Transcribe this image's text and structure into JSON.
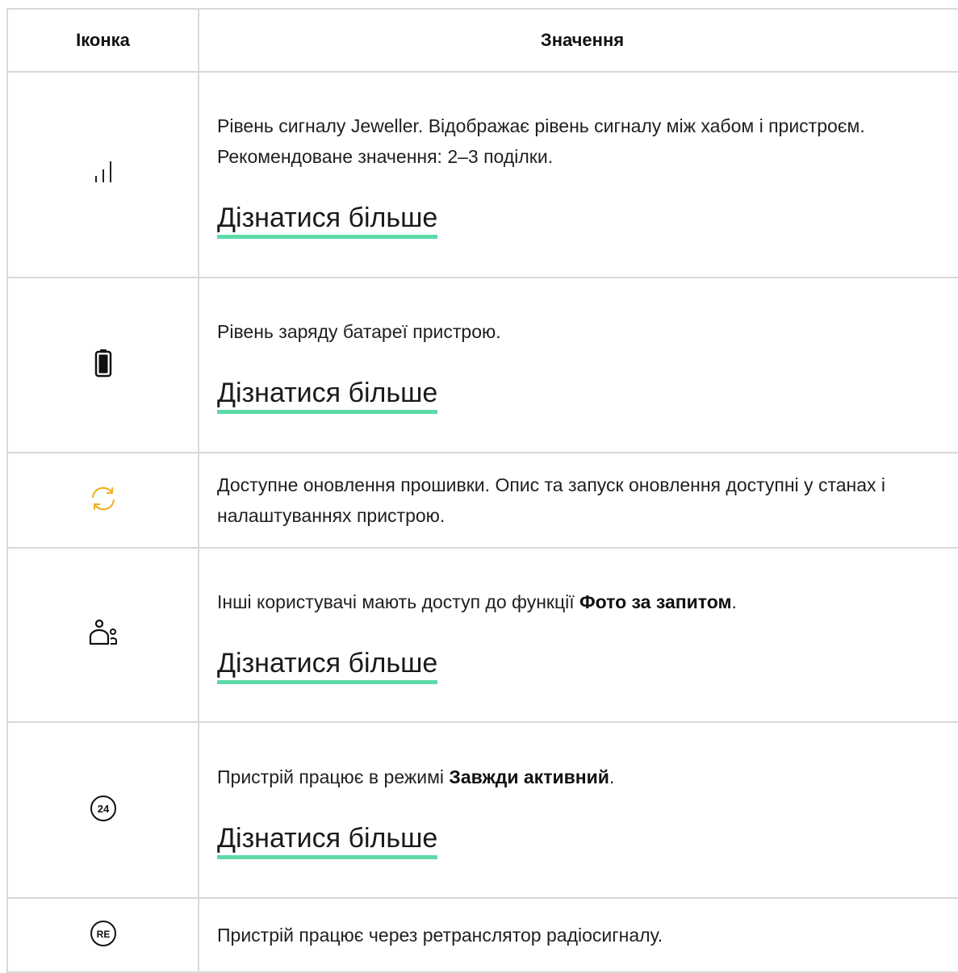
{
  "table": {
    "headers": {
      "icon": "Іконка",
      "meaning": "Значення"
    },
    "rows": [
      {
        "icon": "signal-strength-icon",
        "text": "Рівень сигналу Jeweller. Відображає рівень сигналу між хабом і пристроєм. Рекомендоване значення: 2–3 поділки.",
        "link": "Дізнатися більше"
      },
      {
        "icon": "battery-icon",
        "text": "Рівень заряду батареї пристрою.",
        "link": "Дізнатися більше"
      },
      {
        "icon": "firmware-update-icon",
        "text": "Доступне оновлення прошивки. Опис та запуск оновлення доступні у станах і налаштуваннях пристрою."
      },
      {
        "icon": "users-access-icon",
        "text_before": "Інші користувачі мають доступ до функції ",
        "text_bold": "Фото за запитом",
        "text_after": ".",
        "link": "Дізнатися більше"
      },
      {
        "icon": "always-active-24-icon",
        "icon_label": "24",
        "text_before": "Пристрій працює в режимі ",
        "text_bold": "Завжди активний",
        "text_after": ".",
        "link": "Дізнатися більше"
      },
      {
        "icon": "range-extender-re-icon",
        "icon_label": "RE",
        "text": "Пристрій працює через ретранслятор радіосигналу."
      }
    ]
  },
  "colors": {
    "link_underline": "#5cdba7",
    "update_icon": "#f0b429",
    "border": "#d9d9d9"
  }
}
